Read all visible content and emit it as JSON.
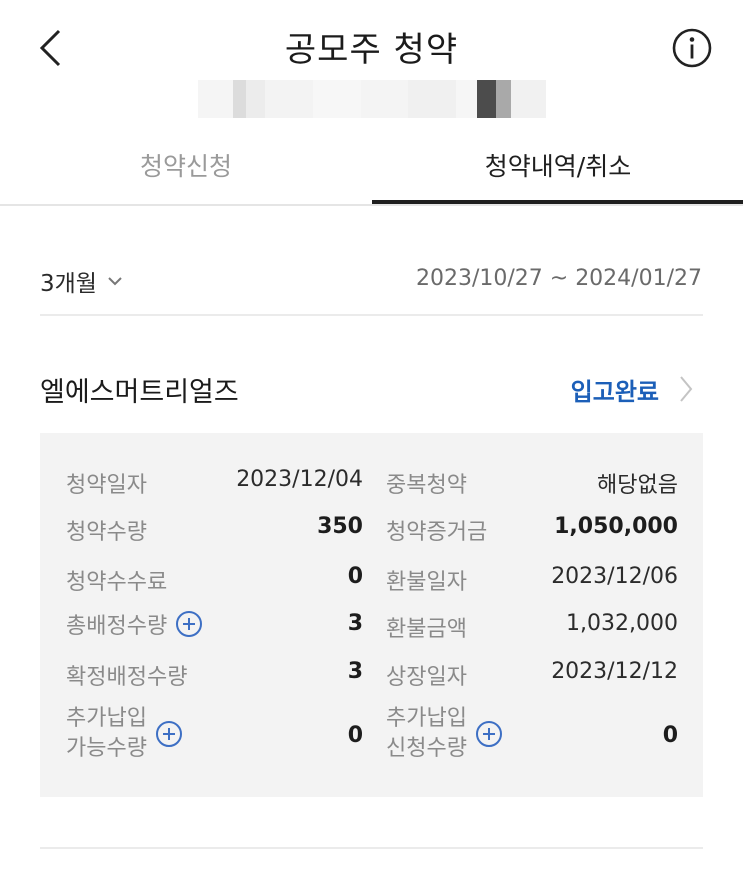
{
  "header": {
    "title": "공모주 청약"
  },
  "tabs": [
    {
      "label": "청약신청",
      "active": false
    },
    {
      "label": "청약내역/취소",
      "active": true
    }
  ],
  "filter": {
    "period": "3개월",
    "date_range": "2023/10/27 ~ 2024/01/27"
  },
  "subscription": {
    "company": "엘에스머트리얼즈",
    "status": "입고완료",
    "left": [
      {
        "label": "청약일자",
        "value": "2023/12/04"
      },
      {
        "label": "청약수량",
        "value": "350"
      },
      {
        "label": "청약수수료",
        "value": "0"
      },
      {
        "label": "총배정수량",
        "value": "3"
      },
      {
        "label": "확정배정수량",
        "value": "3"
      },
      {
        "label_line1": "추가납입",
        "label_line2": "가능수량",
        "value": "0"
      }
    ],
    "right": [
      {
        "label": "중복청약",
        "value": "해당없음"
      },
      {
        "label": "청약증거금",
        "value": "1,050,000"
      },
      {
        "label": "환불일자",
        "value": "2023/12/06"
      },
      {
        "label": "환불금액",
        "value": "1,032,000"
      },
      {
        "label": "상장일자",
        "value": "2023/12/12"
      },
      {
        "label_line1": "추가납입",
        "label_line2": "신청수량",
        "value": "0"
      }
    ]
  },
  "colors": {
    "accent": "#1c5fb8",
    "panel": "#f3f3f3",
    "plus_icon": "#3d6fc4"
  }
}
